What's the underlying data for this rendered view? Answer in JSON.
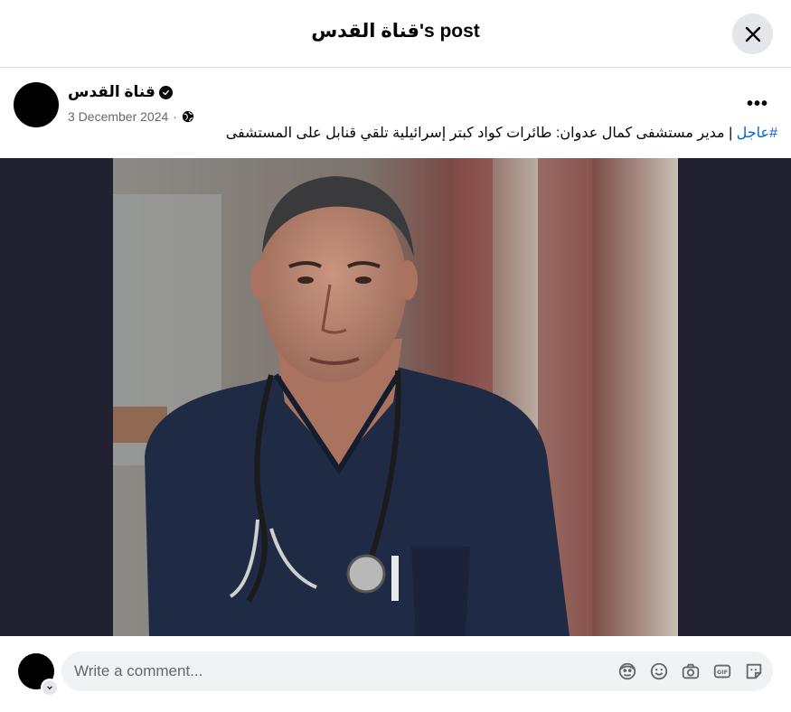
{
  "header": {
    "title": "قناة القدس's post",
    "close_icon": "close-icon"
  },
  "post": {
    "author": "قناة القدس",
    "verified_icon": "verified-badge-icon",
    "date": "3 December 2024",
    "separator": "·",
    "audience_icon": "globe-icon",
    "more_label": "•••",
    "hashtag": "#عاجل",
    "text": " | مدير مستشفى كمال عدوان: طائرات كواد كبتر إسرائيلية تلقي قنابل على المستشفى"
  },
  "comment": {
    "placeholder": "Write a comment...",
    "icons": [
      "avatar-icon",
      "emoji-icon",
      "camera-icon",
      "gif-icon",
      "sticker-icon"
    ]
  },
  "colors": {
    "hashtag": "#0064d1",
    "media_background": "#212131",
    "input_background": "#f0f2f5"
  }
}
